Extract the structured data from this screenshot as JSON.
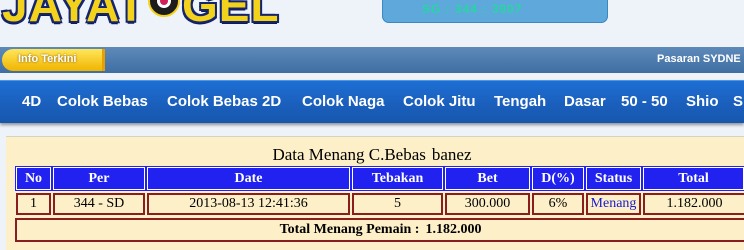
{
  "header": {
    "logo_left": "JAYAT",
    "logo_right": "GEL",
    "result_text": "SG : 344 : 3907"
  },
  "info_bar": {
    "tag": "Info Terkini",
    "marquee": "Pasaran SYDNE"
  },
  "menu": [
    "4D",
    "Colok Bebas",
    "Colok Bebas 2D",
    "Colok Naga",
    "Colok Jitu",
    "Tengah",
    "Dasar",
    "50 - 50",
    "Shio",
    "S"
  ],
  "panel": {
    "title_a": "Data  Menang C.Bebas",
    "title_b": "banez",
    "columns": [
      "No",
      "Per",
      "Date",
      "Tebakan",
      "Bet",
      "D(%)",
      "Status",
      "Total"
    ],
    "rows": [
      [
        "1",
        "344 - SD",
        "2013-08-13 12:41:36",
        "5",
        "300.000",
        "6%",
        "Menang",
        "1.182.000"
      ]
    ],
    "total_label": "Total  Menang  Pemain :",
    "total_value": "1.182.000"
  },
  "colors": {
    "menu_bg": "#1b5fbd",
    "table_header": "#2222f0",
    "cell_border": "#8a1d1d",
    "panel_bg": "#fdf0c8",
    "logo_yellow": "#f3d21c"
  }
}
